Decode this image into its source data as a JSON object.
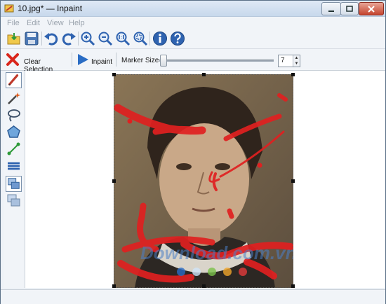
{
  "window": {
    "title": "10.jpg* — Inpaint",
    "controls": [
      "minimize-icon",
      "maximize-icon",
      "close-icon"
    ]
  },
  "menu": {
    "items": [
      "File",
      "Edit",
      "View",
      "Help"
    ]
  },
  "toolbar": {
    "buttons": [
      "open-folder-icon",
      "save-icon",
      "undo-icon",
      "redo-icon",
      "zoom-in-icon",
      "zoom-out-icon",
      "zoom-actual-icon",
      "zoom-fit-icon",
      "info-icon",
      "help-icon"
    ]
  },
  "toolbar2": {
    "clear_selection_label": "Clear Selection",
    "inpaint_label": "Inpaint",
    "marker_size_label": "Marker Size",
    "marker_size_value": "7",
    "marker_size_fraction": 0.02
  },
  "tools": [
    "marker-icon",
    "magic-wand-icon",
    "lasso-icon",
    "polygon-icon",
    "line-icon",
    "stack-icon",
    "layers-icon",
    "layers-secondary-icon"
  ],
  "watermark": {
    "text": "Download.com.vn"
  },
  "colors": {
    "accent": "#3b6ea8",
    "mark": "#e02020",
    "clear_x": "#d9261c",
    "inpaint_arrow": "#2a6cc4"
  }
}
